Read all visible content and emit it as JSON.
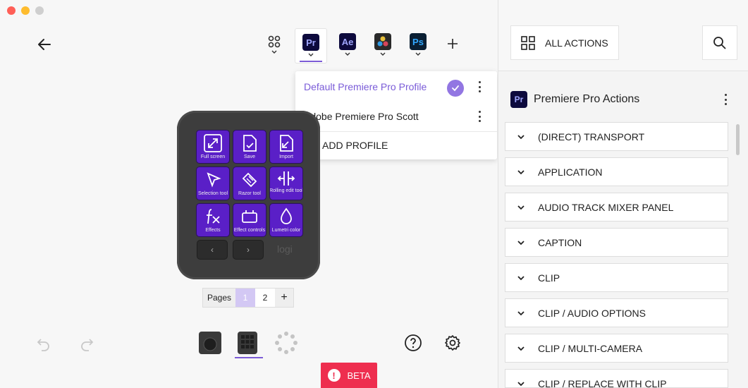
{
  "window": {
    "traffic_lights": [
      "#ff5f57",
      "#febc2e",
      "#cfcfcf"
    ]
  },
  "apps": [
    {
      "name": "all-apps",
      "label": "",
      "bg": "transparent",
      "fg": "#333"
    },
    {
      "name": "premiere-pro",
      "label": "Pr",
      "bg": "#0d0a3d",
      "fg": "#9fa6ff",
      "selected": true
    },
    {
      "name": "after-effects",
      "label": "Ae",
      "bg": "#0d0a3d",
      "fg": "#9fa6ff"
    },
    {
      "name": "davinci-resolve",
      "label": "",
      "bg": "#2a2a2a",
      "fg": "#fff"
    },
    {
      "name": "photoshop",
      "label": "Ps",
      "bg": "#0a1f33",
      "fg": "#31a8ff"
    }
  ],
  "profiles": {
    "items": [
      {
        "label": "Default Premiere Pro Profile",
        "active": true
      },
      {
        "label": "Adobe Premiere Pro Scott",
        "active": false
      }
    ],
    "add_label": "ADD PROFILE"
  },
  "keys": [
    {
      "label": "Full screen",
      "icon": "fullscreen-icon"
    },
    {
      "label": "Save",
      "icon": "save-icon"
    },
    {
      "label": "Import",
      "icon": "import-icon"
    },
    {
      "label": "Selection tool",
      "icon": "selection-tool-icon"
    },
    {
      "label": "Razor tool",
      "icon": "razor-tool-icon"
    },
    {
      "label": "Rolling edit tool",
      "icon": "rolling-edit-icon"
    },
    {
      "label": "Effects",
      "icon": "effects-icon"
    },
    {
      "label": "Effect controls",
      "icon": "effect-controls-icon"
    },
    {
      "label": "Lumetri color",
      "icon": "lumetri-color-icon"
    }
  ],
  "device": {
    "brand": "logi",
    "prev": "‹",
    "next": "›"
  },
  "pages": {
    "label": "Pages",
    "items": [
      "1",
      "2"
    ],
    "active": "1",
    "add": "+"
  },
  "beta_label": "BETA",
  "panel": {
    "all_actions_label": "ALL ACTIONS",
    "section_icon": "Pr",
    "section_title": "Premiere Pro Actions",
    "categories": [
      "(DIRECT) TRANSPORT",
      "APPLICATION",
      "AUDIO TRACK MIXER PANEL",
      "CAPTION",
      "CLIP",
      "CLIP / AUDIO OPTIONS",
      "CLIP / MULTI-CAMERA",
      "CLIP / REPLACE WITH CLIP"
    ]
  },
  "colors": {
    "accent": "#7c5cd6",
    "key_bg": "#5a1fc7",
    "beta": "#ee2e4f"
  }
}
